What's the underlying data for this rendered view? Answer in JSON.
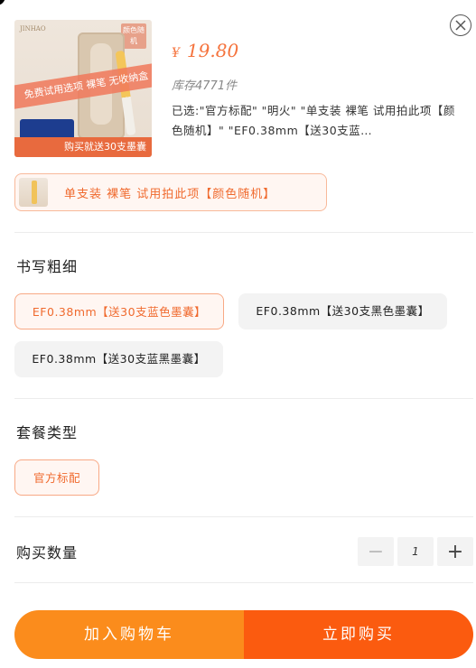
{
  "product": {
    "thumb": {
      "brand_text": "JINHAO",
      "color_tag": "颜色随机",
      "banner_text": "免费试用选项 裸笔 无收纳盒",
      "bottom_text": "购买就送30支墨囊"
    },
    "price_currency": "¥",
    "price_value": "19.80",
    "stock_text": "库存4771件",
    "selected_text": "已选:\"官方标配\" \"明火\" \"单支装 裸笔 试用拍此项【颜色随机】\" \"EF0.38mm【送30支蓝…"
  },
  "style_chip": {
    "label": "单支装 裸笔 试用拍此项【颜色随机】"
  },
  "sections": {
    "nib": {
      "title": "书写粗细",
      "options": [
        {
          "label": "EF0.38mm【送30支蓝色墨囊】",
          "selected": true
        },
        {
          "label": "EF0.38mm【送30支黑色墨囊】",
          "selected": false
        },
        {
          "label": "EF0.38mm【送30支蓝黑墨囊】",
          "selected": false
        }
      ]
    },
    "package": {
      "title": "套餐类型",
      "options": [
        {
          "label": "官方标配",
          "selected": true
        }
      ]
    },
    "quantity": {
      "title": "购买数量",
      "minus": "−",
      "value": "1",
      "plus": "+"
    }
  },
  "buttons": {
    "add_to_cart": "加入购物车",
    "buy_now": "立即购买"
  },
  "colors": {
    "accent": "#f06a2e",
    "cart_button": "#fb8c1c",
    "buy_button": "#fb5b0f"
  }
}
